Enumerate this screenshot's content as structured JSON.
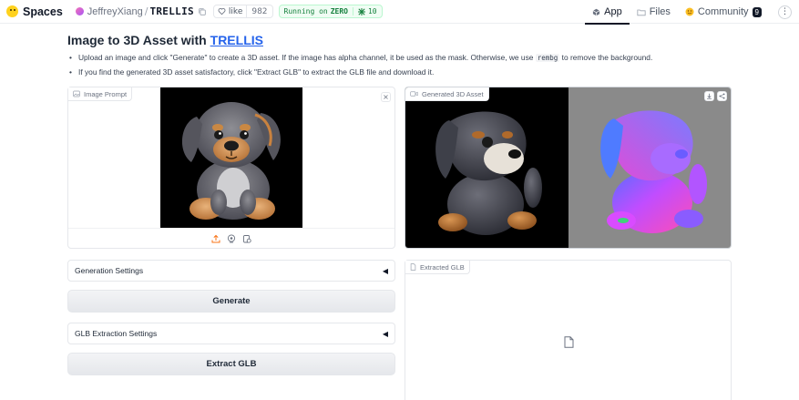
{
  "header": {
    "brand": "Spaces",
    "owner": "JeffreyXiang",
    "separator": "/",
    "repo": "TRELLIS",
    "like_label": "like",
    "like_count": "982",
    "running_prefix": "Running on",
    "running_hw": "ZERO",
    "zero_count": "10",
    "nav": {
      "app": "App",
      "files": "Files",
      "community": "Community",
      "community_count": "9"
    },
    "user_menu": "⋮"
  },
  "page": {
    "title_prefix": "Image to 3D Asset with",
    "title_link": "TRELLIS",
    "bullets": {
      "b1_a": "Upload an image and click \"Generate\" to create a 3D asset. If the image has alpha channel, it be used as the mask. Otherwise, we use",
      "b1_code": "rembg",
      "b1_b": "to remove the background.",
      "b2": "If you find the generated 3D asset satisfactory, click \"Extract GLB\" to extract the GLB file and download it."
    }
  },
  "left": {
    "image_prompt_label": "Image Prompt",
    "close": "×",
    "generation_settings": "Generation Settings",
    "generate": "Generate",
    "glb_settings": "GLB Extraction Settings",
    "extract_glb": "Extract GLB",
    "accordion_arrow": "◀"
  },
  "right": {
    "generated_label": "Generated 3D Asset",
    "extracted_label": "Extracted GLB"
  },
  "colors": {
    "accent_link": "#2563eb",
    "running_green": "#15803d",
    "preview_bg_left": "#000000",
    "preview_bg_right": "#8a8a8a"
  }
}
